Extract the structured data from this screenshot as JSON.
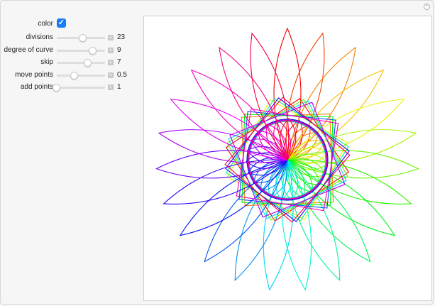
{
  "controls": {
    "color": {
      "label": "color",
      "checked": true
    },
    "sliders": [
      {
        "label": "divisions",
        "value": "23",
        "fraction": 0.55
      },
      {
        "label": "degree of curve",
        "value": "9",
        "fraction": 0.75
      },
      {
        "label": "skip",
        "value": "7",
        "fraction": 0.65
      },
      {
        "label": "move points",
        "value": "0.5",
        "fraction": 0.37
      },
      {
        "label": "add points",
        "value": "1",
        "fraction": 0.0
      }
    ]
  },
  "plot": {
    "divisions": 23,
    "colored": true,
    "accent": "#1a7cf5"
  }
}
